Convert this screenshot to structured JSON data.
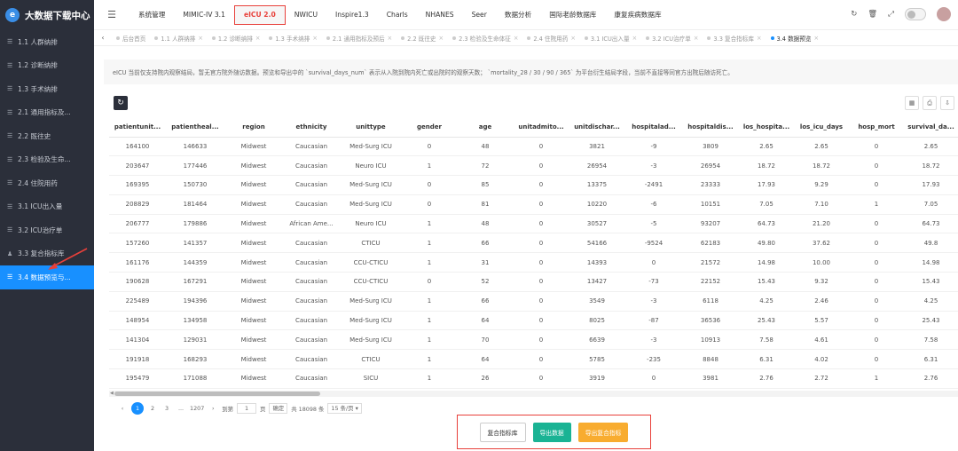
{
  "app": {
    "title": "大数据下载中心"
  },
  "sidebar": {
    "items": [
      {
        "label": "1.1 人群纳排",
        "active": false
      },
      {
        "label": "1.2 诊断纳排",
        "active": false
      },
      {
        "label": "1.3 手术纳排",
        "active": false
      },
      {
        "label": "2.1 通用指标及...",
        "active": false
      },
      {
        "label": "2.2 既往史",
        "active": false
      },
      {
        "label": "2.3 检验及生命...",
        "active": false
      },
      {
        "label": "2.4 住院用药",
        "active": false
      },
      {
        "label": "3.1 ICU出入量",
        "active": false
      },
      {
        "label": "3.2 ICU治疗单",
        "active": false
      },
      {
        "label": "3.3 复合指标库",
        "active": false
      },
      {
        "label": "3.4 数据预览与...",
        "active": true
      }
    ]
  },
  "topnav": {
    "items": [
      {
        "label": "系统管理",
        "selected": false
      },
      {
        "label": "MIMIC-IV 3.1",
        "selected": false
      },
      {
        "label": "eICU 2.0",
        "selected": true
      },
      {
        "label": "NWICU",
        "selected": false
      },
      {
        "label": "Inspire1.3",
        "selected": false
      },
      {
        "label": "Charls",
        "selected": false
      },
      {
        "label": "NHANES",
        "selected": false
      },
      {
        "label": "Seer",
        "selected": false
      },
      {
        "label": "数据分析",
        "selected": false
      },
      {
        "label": "国际老龄数据库",
        "selected": false
      },
      {
        "label": "康复疾病数据库",
        "selected": false
      }
    ]
  },
  "tabs": [
    {
      "label": "后台首页",
      "active": false
    },
    {
      "label": "1.1 人群纳排",
      "active": false
    },
    {
      "label": "1.2 诊断纳排",
      "active": false
    },
    {
      "label": "1.3 手术纳排",
      "active": false
    },
    {
      "label": "2.1 通用指标及预后",
      "active": false
    },
    {
      "label": "2.2 既往史",
      "active": false
    },
    {
      "label": "2.3 检验及生命体征",
      "active": false
    },
    {
      "label": "2.4 住院用药",
      "active": false
    },
    {
      "label": "3.1 ICU出入量",
      "active": false
    },
    {
      "label": "3.2 ICU治疗单",
      "active": false
    },
    {
      "label": "3.3 复合指标库",
      "active": false
    },
    {
      "label": "3.4 数据预览",
      "active": true
    }
  ],
  "notice": "eICU 当前仅支持院内观察结局，暂无官方院外随访数据。预览和导出中的 `survival_days_num` 表示从入院到院内死亡或出院时的观察天数； `mortality_28 / 30 / 90 / 365` 为平台衍生结局字段，当前不直接等同官方出院后随访死亡。",
  "table": {
    "columns": [
      "patientunit...",
      "patientheal...",
      "region",
      "ethnicity",
      "unittype",
      "gender",
      "age",
      "unitadmito...",
      "unitdischar...",
      "hospitalad...",
      "hospitaldis...",
      "los_hospita...",
      "los_icu_days",
      "hosp_mort",
      "survival_da..."
    ],
    "rows": [
      [
        "164100",
        "146633",
        "Midwest",
        "Caucasian",
        "Med-Surg ICU",
        "0",
        "48",
        "0",
        "3821",
        "-9",
        "3809",
        "2.65",
        "2.65",
        "0",
        "2.65"
      ],
      [
        "203647",
        "177446",
        "Midwest",
        "Caucasian",
        "Neuro ICU",
        "1",
        "72",
        "0",
        "26954",
        "-3",
        "26954",
        "18.72",
        "18.72",
        "0",
        "18.72"
      ],
      [
        "169395",
        "150730",
        "Midwest",
        "Caucasian",
        "Med-Surg ICU",
        "0",
        "85",
        "0",
        "13375",
        "-2491",
        "23333",
        "17.93",
        "9.29",
        "0",
        "17.93"
      ],
      [
        "208829",
        "181464",
        "Midwest",
        "Caucasian",
        "Med-Surg ICU",
        "0",
        "81",
        "0",
        "10220",
        "-6",
        "10151",
        "7.05",
        "7.10",
        "1",
        "7.05"
      ],
      [
        "206777",
        "179886",
        "Midwest",
        "African Ame...",
        "Neuro ICU",
        "1",
        "48",
        "0",
        "30527",
        "-5",
        "93207",
        "64.73",
        "21.20",
        "0",
        "64.73"
      ],
      [
        "157260",
        "141357",
        "Midwest",
        "Caucasian",
        "CTICU",
        "1",
        "66",
        "0",
        "54166",
        "-9524",
        "62183",
        "49.80",
        "37.62",
        "0",
        "49.8"
      ],
      [
        "161176",
        "144359",
        "Midwest",
        "Caucasian",
        "CCU-CTICU",
        "1",
        "31",
        "0",
        "14393",
        "0",
        "21572",
        "14.98",
        "10.00",
        "0",
        "14.98"
      ],
      [
        "190628",
        "167291",
        "Midwest",
        "Caucasian",
        "CCU-CTICU",
        "0",
        "52",
        "0",
        "13427",
        "-73",
        "22152",
        "15.43",
        "9.32",
        "0",
        "15.43"
      ],
      [
        "225489",
        "194396",
        "Midwest",
        "Caucasian",
        "Med-Surg ICU",
        "1",
        "66",
        "0",
        "3549",
        "-3",
        "6118",
        "4.25",
        "2.46",
        "0",
        "4.25"
      ],
      [
        "148954",
        "134958",
        "Midwest",
        "Caucasian",
        "Med-Surg ICU",
        "1",
        "64",
        "0",
        "8025",
        "-87",
        "36536",
        "25.43",
        "5.57",
        "0",
        "25.43"
      ],
      [
        "141304",
        "129031",
        "Midwest",
        "Caucasian",
        "Med-Surg ICU",
        "1",
        "70",
        "0",
        "6639",
        "-3",
        "10913",
        "7.58",
        "4.61",
        "0",
        "7.58"
      ],
      [
        "191918",
        "168293",
        "Midwest",
        "Caucasian",
        "CTICU",
        "1",
        "64",
        "0",
        "5785",
        "-235",
        "8848",
        "6.31",
        "4.02",
        "0",
        "6.31"
      ],
      [
        "195479",
        "171088",
        "Midwest",
        "Caucasian",
        "SICU",
        "1",
        "26",
        "0",
        "3919",
        "0",
        "3981",
        "2.76",
        "2.72",
        "1",
        "2.76"
      ]
    ]
  },
  "pager": {
    "pages": [
      "1",
      "2",
      "3",
      "...",
      "1207"
    ],
    "goto_label": "到第",
    "goto_value": "1",
    "page_unit": "页",
    "confirm_label": "确定",
    "total_label": "共 18098 条",
    "page_size": "15 条/页"
  },
  "actions": {
    "composite_label": "复合指标库",
    "export_label": "导出数据",
    "export_composite_label": "导出复合指标"
  },
  "colors": {
    "accent": "#1890ff",
    "highlight": "#e8403a",
    "teal": "#1ab394",
    "orange": "#f8ac30",
    "sidebar": "#2b2f3a"
  }
}
